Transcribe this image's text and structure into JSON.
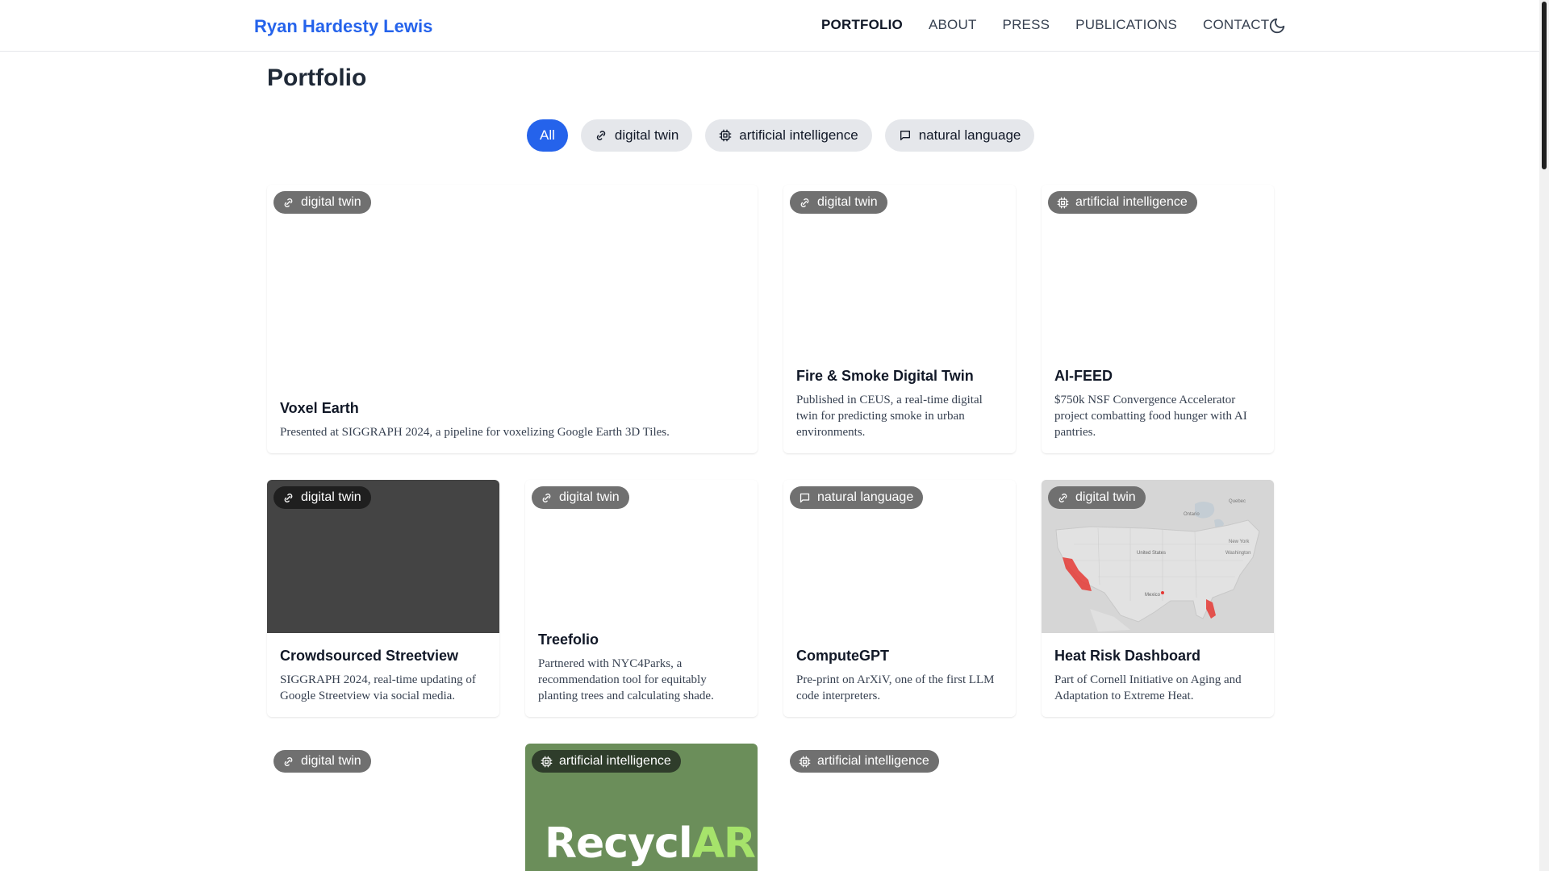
{
  "nav": {
    "brand": "Ryan Hardesty Lewis",
    "links": [
      "PORTFOLIO",
      "ABOUT",
      "PRESS",
      "PUBLICATIONS",
      "CONTACT"
    ],
    "active": "PORTFOLIO",
    "theme_toggle_icon": "moon-icon"
  },
  "page": {
    "title": "Portfolio"
  },
  "filters": {
    "active": "All",
    "items": [
      {
        "label": "All",
        "icon": ""
      },
      {
        "label": "digital twin",
        "icon": "link-icon"
      },
      {
        "label": "artificial intelligence",
        "icon": "chip-icon"
      },
      {
        "label": "natural language",
        "icon": "message-icon"
      }
    ]
  },
  "cards": [
    {
      "title": "Voxel Earth",
      "tag": "digital twin",
      "tag_icon": "link-icon",
      "description": "Presented at SIGGRAPH 2024, a pipeline for voxelizing Google Earth 3D Tiles."
    },
    {
      "title": "Fire & Smoke Digital Twin",
      "tag": "digital twin",
      "tag_icon": "link-icon",
      "description": "Published in CEUS, a real-time digital twin for predicting smoke in urban environments."
    },
    {
      "title": "AI-FEED",
      "tag": "artificial intelligence",
      "tag_icon": "chip-icon",
      "description": "$750k NSF Convergence Accelerator project combatting food hunger with AI pantries."
    },
    {
      "title": "Crowdsourced Streetview",
      "tag": "digital twin",
      "tag_icon": "link-icon",
      "description": "SIGGRAPH 2024, real-time updating of Google Streetview via social media."
    },
    {
      "title": "Treefolio",
      "tag": "digital twin",
      "tag_icon": "link-icon",
      "description": "Partnered with NYC4Parks, a recommendation tool for equitably planting trees and calculating shade."
    },
    {
      "title": "ComputeGPT",
      "tag": "natural language",
      "tag_icon": "message-icon",
      "description": "Pre-print on ArXiV, one of the first LLM code interpreters."
    },
    {
      "title": "Heat Risk Dashboard",
      "tag": "digital twin",
      "tag_icon": "link-icon",
      "description": "Part of Cornell Initiative on Aging and Adaptation to Extreme Heat.",
      "map_labels": [
        "United States",
        "Mexico",
        "Ontario",
        "Quebec",
        "Washington",
        "New York"
      ]
    },
    {
      "tag": "digital twin",
      "tag_icon": "link-icon"
    },
    {
      "tag": "artificial intelligence",
      "tag_icon": "chip-icon",
      "image_text": "Recycl",
      "image_text_accent": "AR"
    },
    {
      "tag": "artificial intelligence",
      "tag_icon": "chip-icon"
    }
  ],
  "colors": {
    "accent": "#2563eb",
    "tag_bg": "#707070",
    "recyclar_bg": "#6b8e5a",
    "streetview_bg": "#444444",
    "map_hotspot": "#e53935"
  }
}
